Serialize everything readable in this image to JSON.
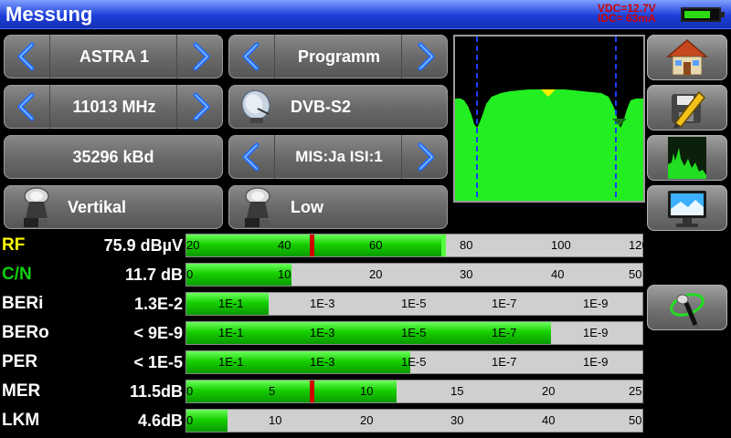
{
  "title": "Messung",
  "power": {
    "vdc": "VDC=12.7V",
    "idc": "IDC= 63mA",
    "battery_level": 0.78
  },
  "controls": {
    "satellite": "ASTRA 1",
    "mode": "Programm",
    "frequency": "11013 MHz",
    "modulation": "DVB-S2",
    "symbol_rate": "35296 kBd",
    "stream": "MIS:Ja ISI:1",
    "polarization": "Vertikal",
    "band": "Low"
  },
  "colors": {
    "bar_fill": "#16d000",
    "marker_red": "#d00000",
    "rf_label": "#ffff00",
    "cn_label": "#10d010",
    "spectrum": "#22ee22"
  },
  "meters": [
    {
      "label": "RF",
      "value": "75.9 dBµV",
      "fill": 0.56,
      "ticks": [
        "20",
        "40",
        "60",
        "80",
        "100",
        "120"
      ],
      "tick_pos": [
        0.0,
        0.2,
        0.4,
        0.6,
        0.8,
        0.97
      ]
    },
    {
      "label": "C/N",
      "value": "11.7 dB",
      "fill": 0.23,
      "ticks": [
        "0",
        "10",
        "20",
        "30",
        "40",
        "50"
      ],
      "tick_pos": [
        0.0,
        0.2,
        0.4,
        0.6,
        0.8,
        0.97
      ]
    },
    {
      "label": "BERi",
      "value": "1.3E-2",
      "fill": 0.18,
      "ticks": [
        "1E-1",
        "1E-3",
        "1E-5",
        "1E-7",
        "1E-9"
      ],
      "tick_pos": [
        0.07,
        0.27,
        0.47,
        0.67,
        0.87
      ]
    },
    {
      "label": "BERo",
      "value": "< 9E-9",
      "fill": 0.8,
      "ticks": [
        "1E-1",
        "1E-3",
        "1E-5",
        "1E-7",
        "1E-9"
      ],
      "tick_pos": [
        0.07,
        0.27,
        0.47,
        0.67,
        0.87
      ]
    },
    {
      "label": "PER",
      "value": "< 1E-5",
      "fill": 0.49,
      "ticks": [
        "1E-1",
        "1E-3",
        "1E-5",
        "1E-7",
        "1E-9"
      ],
      "tick_pos": [
        0.07,
        0.27,
        0.47,
        0.67,
        0.87
      ]
    },
    {
      "label": "MER",
      "value": "11.5dB",
      "fill": 0.46,
      "ticks": [
        "0",
        "5",
        "10",
        "15",
        "20",
        "25"
      ],
      "tick_pos": [
        0.0,
        0.18,
        0.38,
        0.58,
        0.78,
        0.97
      ]
    },
    {
      "label": "LKM",
      "value": "4.6dB",
      "fill": 0.09,
      "ticks": [
        "0",
        "10",
        "20",
        "30",
        "40",
        "50"
      ],
      "tick_pos": [
        0.0,
        0.18,
        0.38,
        0.58,
        0.78,
        0.97
      ]
    }
  ],
  "markers": {
    "rf": [
      0.27,
      0.56
    ],
    "mer": 0.27
  }
}
